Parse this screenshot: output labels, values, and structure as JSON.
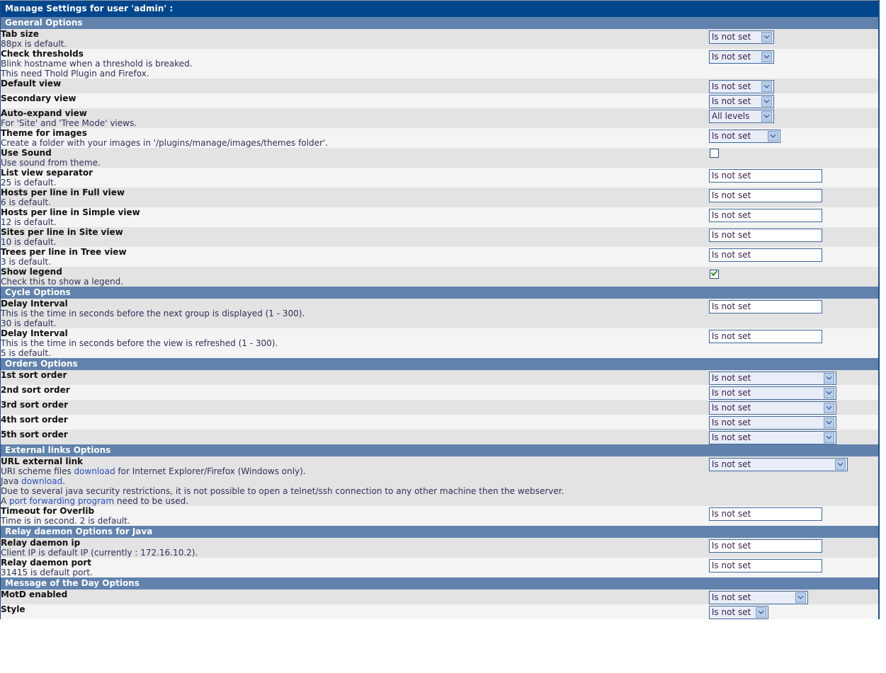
{
  "page": {
    "title": "Manage Settings for user 'admin' :"
  },
  "values": {
    "is_not_set": "Is not set",
    "all_levels": "All levels"
  },
  "sections": [
    {
      "id": "general",
      "header": "General Options",
      "rows": [
        {
          "title": "Tab size",
          "desc": [
            "88px is default."
          ],
          "control": "select",
          "value": "Is not set",
          "width": "w-smp"
        },
        {
          "title": "Check thresholds",
          "desc": [
            "Blink hostname when a threshold is breaked.",
            "This need Thold Plugin and Firefox."
          ],
          "control": "select",
          "value": "Is not set",
          "width": "w-smp"
        },
        {
          "title": "Default view",
          "desc": [],
          "control": "select",
          "value": "Is not set",
          "width": "w-smp"
        },
        {
          "title": "Secondary view",
          "desc": [],
          "control": "select",
          "value": "Is not set",
          "width": "w-smp"
        },
        {
          "title": "Auto-expand view",
          "desc": [
            "For 'Site' and 'Tree Mode' views."
          ],
          "control": "select",
          "value": "All levels",
          "width": "w-smp"
        },
        {
          "title": "Theme for images",
          "desc": [
            "Create a folder with your images in '/plugins/manage/images/themes folder'."
          ],
          "control": "select",
          "value": "Is not set",
          "width": "w-med"
        },
        {
          "title": "Use Sound",
          "desc": [
            "Use sound from theme."
          ],
          "control": "checkbox",
          "checked": false
        },
        {
          "title": "List view separator",
          "desc": [
            "25 is default."
          ],
          "control": "text",
          "value": "Is not set"
        },
        {
          "title": "Hosts per line in Full view",
          "desc": [
            "6 is default."
          ],
          "control": "text",
          "value": "Is not set"
        },
        {
          "title": "Hosts per line in Simple view",
          "desc": [
            "12 is default."
          ],
          "control": "text",
          "value": "Is not set"
        },
        {
          "title": "Sites per line in Site view",
          "desc": [
            "10 is default."
          ],
          "control": "text",
          "value": "Is not set"
        },
        {
          "title": "Trees per line in Tree view",
          "desc": [
            "3 is default."
          ],
          "control": "text",
          "value": "Is not set"
        },
        {
          "title": "Show legend",
          "desc": [
            "Check this to show a legend."
          ],
          "control": "checkbox",
          "checked": true
        }
      ]
    },
    {
      "id": "cycle",
      "header": "Cycle Options",
      "rows": [
        {
          "title": "Delay Interval",
          "desc": [
            "This is the time in seconds before the next group is displayed (1 - 300).",
            "30 is default."
          ],
          "control": "text",
          "value": "Is not set"
        },
        {
          "title": "Delay Interval",
          "desc": [
            "This is the time in seconds before the view is refreshed (1 - 300).",
            "5 is default."
          ],
          "control": "text",
          "value": "Is not set"
        }
      ]
    },
    {
      "id": "orders",
      "header": "Orders Options",
      "rows": [
        {
          "title": "1st sort order",
          "desc": [],
          "control": "select",
          "value": "Is not set",
          "width": "w-xl"
        },
        {
          "title": "2nd sort order",
          "desc": [],
          "control": "select",
          "value": "Is not set",
          "width": "w-xl"
        },
        {
          "title": "3rd sort order",
          "desc": [],
          "control": "select",
          "value": "Is not set",
          "width": "w-xl"
        },
        {
          "title": "4th sort order",
          "desc": [],
          "control": "select",
          "value": "Is not set",
          "width": "w-xl"
        },
        {
          "title": "5th sort order",
          "desc": [],
          "control": "select",
          "value": "Is not set",
          "width": "w-xl"
        }
      ]
    },
    {
      "id": "external",
      "header": "External links Options",
      "rows": [
        {
          "title": "URL external link",
          "desc_rich": [
            [
              {
                "t": "URI scheme files "
              },
              {
                "t": "download",
                "link": true
              },
              {
                "t": " for Internet Explorer/Firefox (Windows only)."
              }
            ],
            [
              {
                "t": "Java "
              },
              {
                "t": "download",
                "link": true
              },
              {
                "t": "."
              }
            ],
            [
              {
                "t": "Due to several java security restrictions, it is not possible to open a telnet/ssh connection to any other machine then the webserver."
              }
            ],
            [
              {
                "t": "A "
              },
              {
                "t": "port forwarding program",
                "link": true
              },
              {
                "t": " need to be used."
              }
            ]
          ],
          "control": "select",
          "value": "Is not set",
          "width": "w-xxl"
        },
        {
          "title": "Timeout for Overlib",
          "desc": [
            "Time is in second. 2 is default."
          ],
          "control": "text",
          "value": "Is not set"
        }
      ]
    },
    {
      "id": "relay",
      "header": "Relay daemon Options for Java",
      "rows": [
        {
          "title": "Relay daemon ip",
          "desc": [
            "Client IP is default IP (currently : 172.16.10.2)."
          ],
          "control": "text",
          "value": "Is not set"
        },
        {
          "title": "Relay daemon port",
          "desc": [
            "31415 is default port."
          ],
          "control": "text",
          "value": "Is not set"
        }
      ]
    },
    {
      "id": "motd",
      "header": "Message of the Day Options",
      "rows": [
        {
          "title": "MotD enabled",
          "desc": [],
          "control": "select",
          "value": "Is not set",
          "width": "w-lg"
        },
        {
          "title": "Style",
          "desc": [],
          "control": "select",
          "value": "Is not set",
          "width": "w-sm"
        }
      ]
    }
  ],
  "colors": {
    "title_bar": "#00468d",
    "section_bar": "#6182ad",
    "row_dark": "#e3e3e3",
    "row_light": "#f4f4f4",
    "link": "#2a4fbd",
    "check_green": "#1a8a1a"
  }
}
